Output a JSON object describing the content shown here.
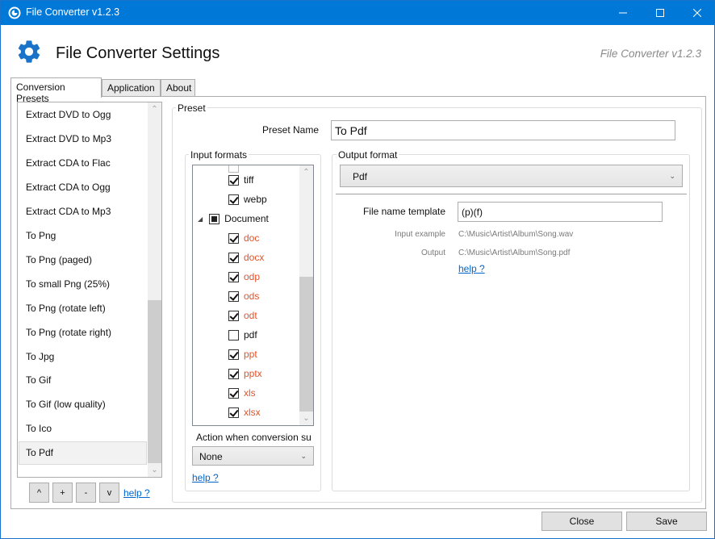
{
  "window": {
    "title": "File Converter v1.2.3",
    "controls": {
      "minimize": "minimize",
      "maximize": "maximize",
      "close": "close"
    }
  },
  "header": {
    "title": "File Converter Settings",
    "version": "File Converter v1.2.3",
    "icon": "gear-icon"
  },
  "tabs": [
    {
      "label": "Conversion Presets",
      "active": true
    },
    {
      "label": "Application",
      "active": false
    },
    {
      "label": "About",
      "active": false
    }
  ],
  "presets": {
    "items": [
      "Extract DVD to Ogg",
      "Extract DVD to Mp3",
      "Extract CDA to Flac",
      "Extract CDA to Ogg",
      "Extract CDA to Mp3",
      "To Png",
      "To Png (paged)",
      "To small Png (25%)",
      "To Png (rotate left)",
      "To Png (rotate right)",
      "To Jpg",
      "To Gif",
      "To Gif (low quality)",
      "To Ico",
      "To Pdf"
    ],
    "selected": "To Pdf",
    "buttons": {
      "up": "^",
      "add": "+",
      "remove": "-",
      "down": "v"
    },
    "help_label": "help ?"
  },
  "preset": {
    "group_label": "Preset",
    "name_label": "Preset Name",
    "name_value": "To Pdf",
    "input_formats": {
      "group_label": "Input formats",
      "items": [
        {
          "label": "tiff",
          "checked": true,
          "modified": false,
          "level": 1
        },
        {
          "label": "webp",
          "checked": true,
          "modified": false,
          "level": 1
        },
        {
          "label": "Document",
          "checked": "partial",
          "modified": false,
          "level": 0,
          "expanded": true
        },
        {
          "label": "doc",
          "checked": true,
          "modified": true,
          "level": 1
        },
        {
          "label": "docx",
          "checked": true,
          "modified": true,
          "level": 1
        },
        {
          "label": "odp",
          "checked": true,
          "modified": true,
          "level": 1
        },
        {
          "label": "ods",
          "checked": true,
          "modified": true,
          "level": 1
        },
        {
          "label": "odt",
          "checked": true,
          "modified": true,
          "level": 1
        },
        {
          "label": "pdf",
          "checked": false,
          "modified": false,
          "level": 1
        },
        {
          "label": "ppt",
          "checked": true,
          "modified": true,
          "level": 1
        },
        {
          "label": "pptx",
          "checked": true,
          "modified": true,
          "level": 1
        },
        {
          "label": "xls",
          "checked": true,
          "modified": true,
          "level": 1
        },
        {
          "label": "xlsx",
          "checked": true,
          "modified": true,
          "level": 1
        }
      ],
      "action_label": "Action when conversion su",
      "action_value": "None",
      "help_label": "help ?"
    },
    "output_format": {
      "group_label": "Output format",
      "value": "Pdf",
      "file_name_template_label": "File name template",
      "file_name_template_value": "(p)(f)",
      "input_example_label": "Input example",
      "input_example_value": "C:\\Music\\Artist\\Album\\Song.wav",
      "output_label": "Output",
      "output_value": "C:\\Music\\Artist\\Album\\Song.pdf",
      "help_label": "help ?"
    }
  },
  "footer": {
    "close_label": "Close",
    "save_label": "Save"
  },
  "colors": {
    "titlebar": "#0078d7",
    "modified_text": "#e0522a",
    "link": "#0066cc",
    "gear": "#1a73c9"
  }
}
